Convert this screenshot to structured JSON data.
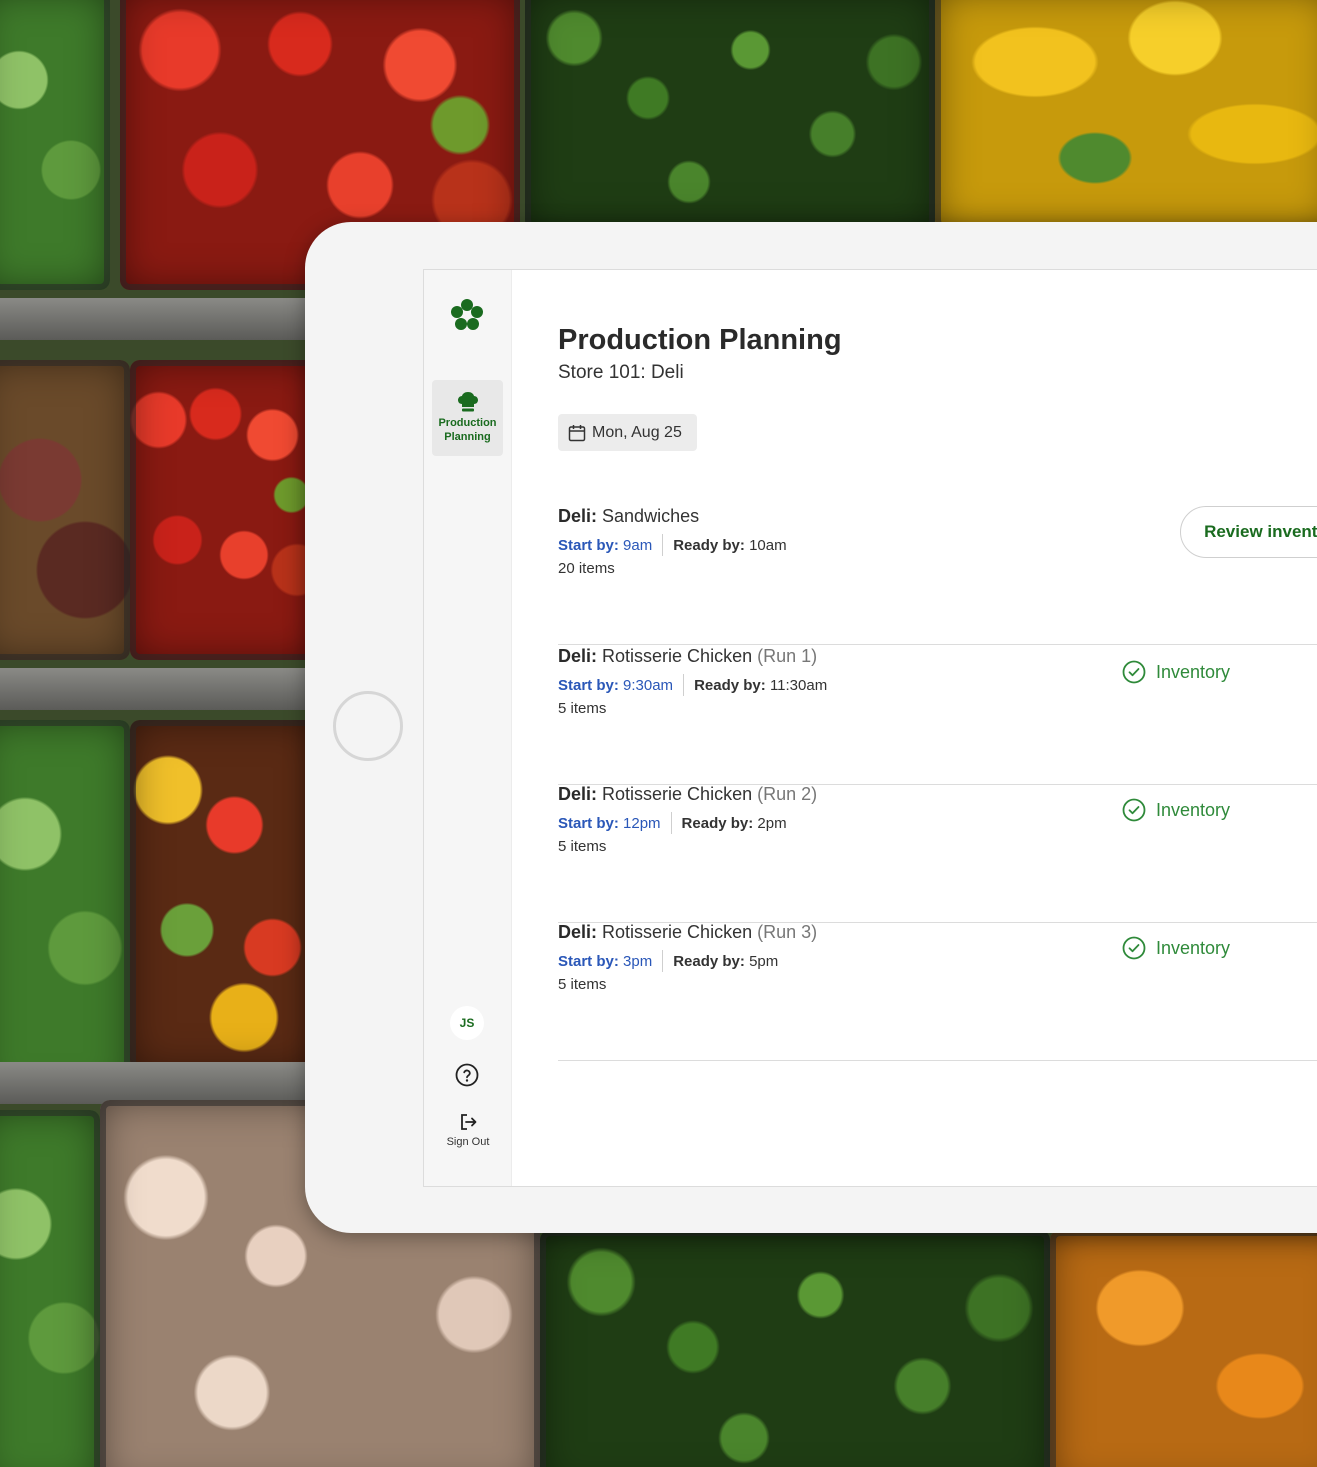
{
  "colors": {
    "brand_green": "#1a6b1f",
    "start_blue": "#2a57b8",
    "status_green": "#2f8a3a"
  },
  "sidebar": {
    "logo_icon": "flower-logo-icon",
    "nav_items": [
      {
        "label_line1": "Production",
        "label_line2": "Planning",
        "icon": "chef-hat-icon",
        "active": true
      }
    ],
    "user_initials": "JS",
    "help_icon": "question-circle-icon",
    "signout_label": "Sign Out",
    "signout_icon": "sign-out-icon"
  },
  "page": {
    "title": "Production Planning",
    "subtitle": "Store 101: Deli",
    "date_label": "Mon, Aug 25",
    "date_icon": "calendar-icon"
  },
  "tasks": [
    {
      "dept": "Deli:",
      "name": "Sandwiches",
      "run": "",
      "start_label": "Start by:",
      "start": "9am",
      "ready_label": "Ready by:",
      "ready": "10am",
      "count": "20 items",
      "action": "Review inventory"
    },
    {
      "dept": "Deli:",
      "name": "Rotisserie Chicken",
      "run": "(Run 1)",
      "start_label": "Start by:",
      "start": "9:30am",
      "ready_label": "Ready by:",
      "ready": "11:30am",
      "count": "5 items",
      "status": "Inventory",
      "status_icon": "check-circle-icon"
    },
    {
      "dept": "Deli:",
      "name": "Rotisserie Chicken",
      "run": "(Run 2)",
      "start_label": "Start by:",
      "start": "12pm",
      "ready_label": "Ready by:",
      "ready": "2pm",
      "count": "5 items",
      "status": "Inventory",
      "status_icon": "check-circle-icon"
    },
    {
      "dept": "Deli:",
      "name": "Rotisserie Chicken",
      "run": "(Run 3)",
      "start_label": "Start by:",
      "start": "3pm",
      "ready_label": "Ready by:",
      "ready": "5pm",
      "count": "5 items",
      "status": "Inventory",
      "status_icon": "check-circle-icon"
    }
  ]
}
